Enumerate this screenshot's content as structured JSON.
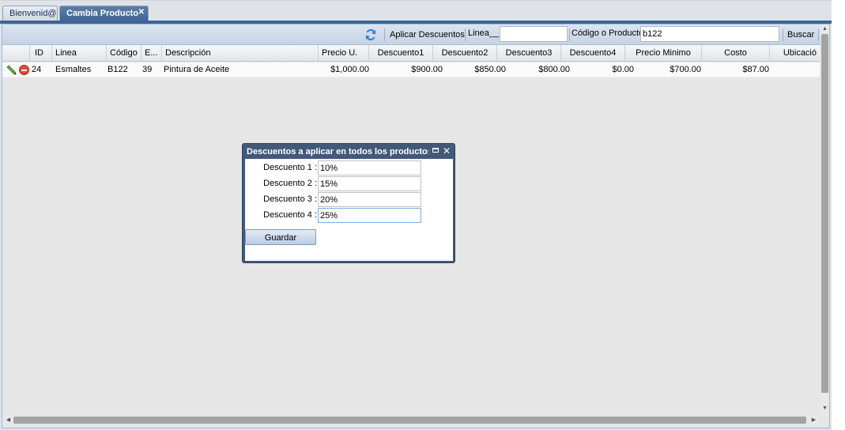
{
  "tabs": [
    {
      "label": "Bienvenid@",
      "active": false
    },
    {
      "label": "Cambia Producto",
      "active": true
    }
  ],
  "toolbar": {
    "refresh_icon": "refresh-icon",
    "apply_discounts_label": "Aplicar Descuentos",
    "line_label": "Linea__ :",
    "line_value": "",
    "code_label": "Código o Producto :",
    "code_value": "b122",
    "search_label": "Buscar"
  },
  "grid": {
    "columns": [
      "ID",
      "Linea",
      "Código",
      "E...",
      "Descripción",
      "Precio U.",
      "Descuento1",
      "Descuento2",
      "Descuento3",
      "Descuento4",
      "Precio Minimo",
      "Costo",
      "Ubicació"
    ],
    "rows": [
      {
        "id": "24",
        "linea": "Esmaltes",
        "codigo": "B122",
        "e": "39",
        "descripcion": "Pintura de Aceite",
        "precio_u": "$1,000.00",
        "descuento1": "$900.00",
        "descuento2": "$850.00",
        "descuento3": "$800.00",
        "descuento4": "$0.00",
        "precio_minimo": "$700.00",
        "costo": "$87.00",
        "ubicacion": ""
      }
    ]
  },
  "dialog": {
    "title": "Descuentos a aplicar en todos los productos.",
    "fields": [
      {
        "label": "Descuento 1 :",
        "value": "10%"
      },
      {
        "label": "Descuento 2 :",
        "value": "15%"
      },
      {
        "label": "Descuento 3 :",
        "value": "20%"
      },
      {
        "label": "Descuento 4 :",
        "value": "25%"
      }
    ],
    "save_label": "Guardar"
  },
  "colors": {
    "active_tab": "#4a6e9b",
    "dialog_frame": "#42597a",
    "delete_icon": "#e04a3a",
    "edit_icon": "#6aa84f"
  }
}
